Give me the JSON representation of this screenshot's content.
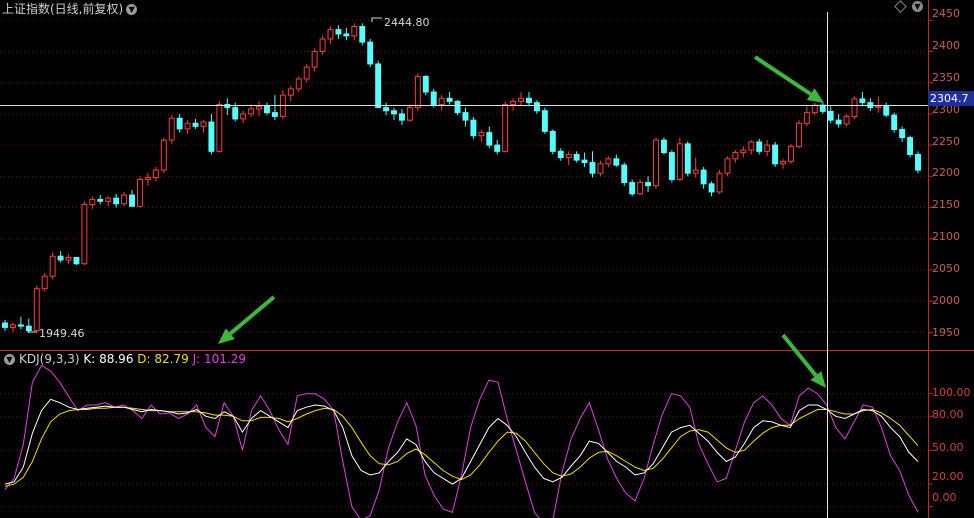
{
  "header": {
    "index_title": "上证指数(日线,前复权)",
    "kdj_name": "KDJ(9,3,3)",
    "k_label": "K: 88.96",
    "d_label": "D: 82.79",
    "j_label": "J: 101.29"
  },
  "crosshair_price": "2304.7",
  "price_axis_labels": [
    "2450",
    "2400",
    "2350",
    "2300",
    "2250",
    "2200",
    "2150",
    "2100",
    "2050",
    "2000",
    "1950"
  ],
  "kdj_axis_labels": [
    "100.00",
    "80.00",
    "50.00",
    "20.00",
    "0.00"
  ],
  "high_annotation": "2444.80",
  "low_annotation": "1949.46",
  "colors": {
    "up": "#ff3b3b",
    "down": "#54ffff",
    "k": "#ffffff",
    "d": "#f0e000",
    "j": "#e040e0",
    "grid": "#6e1010",
    "axis": "#cc2222",
    "arrow": "#3cb83c"
  },
  "chart_data": {
    "type": "candlestick",
    "ohlc": [
      [
        1965,
        1970,
        1952,
        1958
      ],
      [
        1958,
        1966,
        1950,
        1962
      ],
      [
        1962,
        1975,
        1955,
        1960
      ],
      [
        1960,
        1972,
        1949,
        1953
      ],
      [
        1953,
        2025,
        1950,
        2020
      ],
      [
        2020,
        2045,
        2015,
        2040
      ],
      [
        2040,
        2078,
        2035,
        2072
      ],
      [
        2072,
        2080,
        2062,
        2066
      ],
      [
        2066,
        2075,
        2060,
        2070
      ],
      [
        2070,
        2068,
        2058,
        2060
      ],
      [
        2060,
        2160,
        2058,
        2155
      ],
      [
        2155,
        2168,
        2148,
        2163
      ],
      [
        2163,
        2170,
        2155,
        2160
      ],
      [
        2160,
        2168,
        2152,
        2165
      ],
      [
        2165,
        2172,
        2150,
        2156
      ],
      [
        2156,
        2175,
        2152,
        2170
      ],
      [
        2170,
        2178,
        2160,
        2152
      ],
      [
        2152,
        2200,
        2150,
        2195
      ],
      [
        2195,
        2205,
        2185,
        2198
      ],
      [
        2198,
        2215,
        2192,
        2210
      ],
      [
        2210,
        2262,
        2205,
        2258
      ],
      [
        2258,
        2298,
        2252,
        2293
      ],
      [
        2293,
        2300,
        2270,
        2276
      ],
      [
        2276,
        2290,
        2268,
        2285
      ],
      [
        2285,
        2292,
        2276,
        2280
      ],
      [
        2280,
        2290,
        2270,
        2287
      ],
      [
        2287,
        2300,
        2235,
        2240
      ],
      [
        2240,
        2320,
        2238,
        2315
      ],
      [
        2315,
        2325,
        2298,
        2310
      ],
      [
        2310,
        2318,
        2288,
        2292
      ],
      [
        2292,
        2305,
        2285,
        2300
      ],
      [
        2300,
        2315,
        2295,
        2308
      ],
      [
        2308,
        2320,
        2296,
        2312
      ],
      [
        2312,
        2318,
        2298,
        2302
      ],
      [
        2302,
        2330,
        2290,
        2296
      ],
      [
        2296,
        2338,
        2292,
        2330
      ],
      [
        2330,
        2345,
        2320,
        2340
      ],
      [
        2340,
        2360,
        2335,
        2356
      ],
      [
        2356,
        2380,
        2350,
        2375
      ],
      [
        2375,
        2405,
        2368,
        2400
      ],
      [
        2400,
        2425,
        2395,
        2420
      ],
      [
        2420,
        2440,
        2412,
        2435
      ],
      [
        2435,
        2442,
        2420,
        2428
      ],
      [
        2428,
        2438,
        2418,
        2425
      ],
      [
        2425,
        2445,
        2418,
        2440
      ],
      [
        2440,
        2445,
        2410,
        2415
      ],
      [
        2415,
        2420,
        2375,
        2380
      ],
      [
        2380,
        2385,
        2340,
        2310
      ],
      [
        2310,
        2318,
        2298,
        2305
      ],
      [
        2305,
        2310,
        2290,
        2300
      ],
      [
        2300,
        2308,
        2282,
        2290
      ],
      [
        2290,
        2315,
        2287,
        2310
      ],
      [
        2310,
        2365,
        2305,
        2360
      ],
      [
        2360,
        2362,
        2330,
        2335
      ],
      [
        2335,
        2340,
        2310,
        2315
      ],
      [
        2315,
        2330,
        2305,
        2325
      ],
      [
        2325,
        2335,
        2315,
        2320
      ],
      [
        2320,
        2322,
        2298,
        2302
      ],
      [
        2302,
        2310,
        2280,
        2290
      ],
      [
        2290,
        2295,
        2260,
        2265
      ],
      [
        2265,
        2275,
        2255,
        2270
      ],
      [
        2270,
        2280,
        2245,
        2250
      ],
      [
        2250,
        2258,
        2235,
        2240
      ],
      [
        2240,
        2320,
        2238,
        2315
      ],
      [
        2315,
        2325,
        2305,
        2320
      ],
      [
        2320,
        2335,
        2312,
        2325
      ],
      [
        2325,
        2335,
        2314,
        2318
      ],
      [
        2318,
        2322,
        2300,
        2305
      ],
      [
        2305,
        2310,
        2268,
        2272
      ],
      [
        2272,
        2275,
        2235,
        2240
      ],
      [
        2240,
        2245,
        2225,
        2230
      ],
      [
        2230,
        2240,
        2218,
        2235
      ],
      [
        2235,
        2240,
        2222,
        2226
      ],
      [
        2226,
        2238,
        2215,
        2222
      ],
      [
        2222,
        2240,
        2198,
        2205
      ],
      [
        2205,
        2225,
        2200,
        2220
      ],
      [
        2220,
        2232,
        2215,
        2228
      ],
      [
        2228,
        2235,
        2215,
        2218
      ],
      [
        2218,
        2222,
        2185,
        2190
      ],
      [
        2190,
        2195,
        2168,
        2172
      ],
      [
        2172,
        2195,
        2170,
        2190
      ],
      [
        2190,
        2200,
        2175,
        2185
      ],
      [
        2185,
        2262,
        2180,
        2258
      ],
      [
        2258,
        2262,
        2235,
        2238
      ],
      [
        2238,
        2242,
        2190,
        2195
      ],
      [
        2195,
        2262,
        2192,
        2252
      ],
      [
        2252,
        2256,
        2200,
        2205
      ],
      [
        2205,
        2230,
        2198,
        2210
      ],
      [
        2210,
        2215,
        2180,
        2188
      ],
      [
        2188,
        2192,
        2168,
        2175
      ],
      [
        2175,
        2210,
        2172,
        2205
      ],
      [
        2205,
        2232,
        2200,
        2228
      ],
      [
        2228,
        2242,
        2222,
        2238
      ],
      [
        2238,
        2248,
        2230,
        2242
      ],
      [
        2242,
        2258,
        2235,
        2255
      ],
      [
        2255,
        2260,
        2235,
        2240
      ],
      [
        2240,
        2258,
        2232,
        2250
      ],
      [
        2250,
        2255,
        2215,
        2220
      ],
      [
        2220,
        2228,
        2212,
        2224
      ],
      [
        2224,
        2252,
        2220,
        2248
      ],
      [
        2248,
        2290,
        2245,
        2285
      ],
      [
        2285,
        2312,
        2280,
        2302
      ],
      [
        2302,
        2318,
        2298,
        2314
      ],
      [
        2314,
        2318,
        2300,
        2304
      ],
      [
        2304,
        2312,
        2285,
        2290
      ],
      [
        2290,
        2300,
        2278,
        2284
      ],
      [
        2284,
        2300,
        2280,
        2296
      ],
      [
        2296,
        2328,
        2292,
        2324
      ],
      [
        2324,
        2335,
        2312,
        2318
      ],
      [
        2318,
        2325,
        2305,
        2310
      ],
      [
        2310,
        2328,
        2302,
        2312
      ],
      [
        2312,
        2318,
        2295,
        2298
      ],
      [
        2298,
        2302,
        2270,
        2275
      ],
      [
        2275,
        2280,
        2255,
        2262
      ],
      [
        2262,
        2265,
        2230,
        2235
      ],
      [
        2235,
        2240,
        2205,
        2210
      ]
    ],
    "kdj": {
      "k": [
        20,
        22,
        35,
        65,
        85,
        95,
        92,
        88,
        86,
        87,
        88,
        89,
        88,
        88,
        86,
        84,
        86,
        85,
        84,
        82,
        83,
        86,
        80,
        78,
        84,
        80,
        66,
        78,
        85,
        80,
        75,
        70,
        85,
        88,
        90,
        89,
        85,
        70,
        45,
        32,
        28,
        30,
        40,
        48,
        60,
        55,
        40,
        30,
        25,
        20,
        25,
        40,
        55,
        70,
        78,
        72,
        62,
        48,
        35,
        25,
        22,
        26,
        36,
        45,
        58,
        56,
        48,
        40,
        35,
        28,
        30,
        38,
        52,
        66,
        70,
        72,
        65,
        58,
        48,
        40,
        44,
        56,
        70,
        76,
        75,
        72,
        70,
        85,
        90,
        90,
        86,
        80,
        78,
        82,
        86,
        85,
        80,
        70,
        62,
        48,
        40
      ],
      "d": [
        18,
        20,
        26,
        40,
        60,
        75,
        82,
        85,
        86,
        86,
        87,
        87,
        88,
        88,
        87,
        86,
        85,
        85,
        84,
        84,
        84,
        84,
        83,
        81,
        81,
        80,
        76,
        76,
        79,
        79,
        78,
        75,
        78,
        82,
        85,
        87,
        86,
        80,
        70,
        57,
        45,
        38,
        37,
        40,
        47,
        51,
        46,
        39,
        32,
        27,
        24,
        28,
        37,
        48,
        58,
        66,
        65,
        58,
        48,
        38,
        30,
        27,
        29,
        35,
        43,
        48,
        49,
        45,
        40,
        35,
        32,
        34,
        42,
        52,
        62,
        67,
        68,
        66,
        59,
        52,
        48,
        50,
        58,
        65,
        70,
        72,
        72,
        78,
        82,
        86,
        86,
        84,
        82,
        82,
        85,
        86,
        83,
        78,
        72,
        63,
        54
      ],
      "j": [
        15,
        25,
        55,
        110,
        125,
        120,
        110,
        97,
        85,
        90,
        90,
        92,
        88,
        90,
        85,
        78,
        90,
        82,
        83,
        78,
        82,
        90,
        70,
        62,
        92,
        80,
        50,
        85,
        98,
        85,
        68,
        55,
        98,
        100,
        100,
        95,
        85,
        40,
        0,
        -12,
        -8,
        15,
        52,
        75,
        92,
        72,
        28,
        10,
        -2,
        -5,
        28,
        70,
        95,
        112,
        110,
        78,
        50,
        22,
        -5,
        -15,
        -12,
        30,
        60,
        78,
        92,
        68,
        42,
        25,
        12,
        5,
        25,
        55,
        82,
        100,
        98,
        88,
        55,
        38,
        22,
        25,
        50,
        75,
        92,
        98,
        90,
        78,
        72,
        98,
        105,
        100,
        90,
        70,
        60,
        75,
        90,
        88,
        70,
        45,
        32,
        10,
        -5
      ]
    },
    "price_range": [
      1925,
      2460
    ],
    "kdj_range": [
      -10,
      128
    ],
    "high": {
      "value": 2444.8
    },
    "low": {
      "value": 1949.46
    }
  }
}
